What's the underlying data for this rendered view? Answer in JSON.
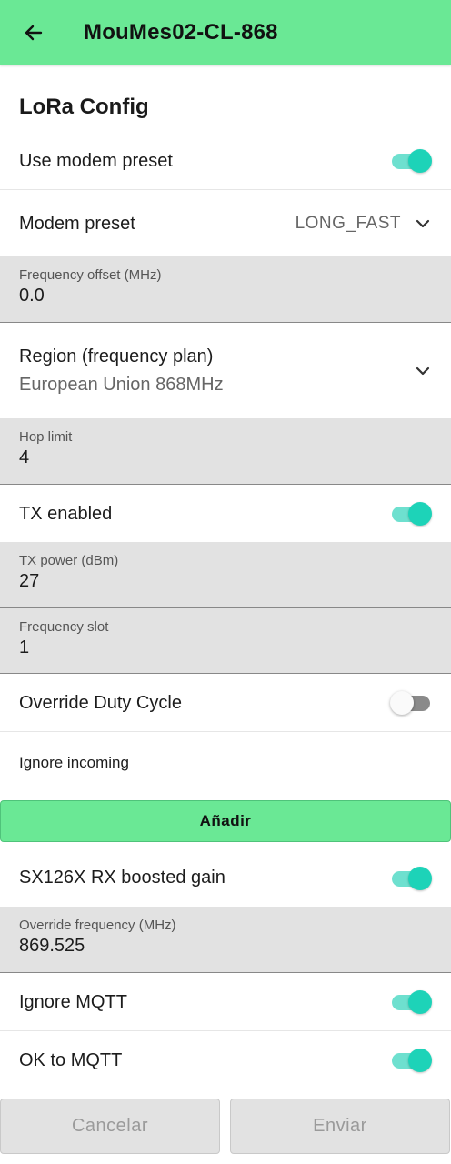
{
  "appbar": {
    "title": "MouMes02-CL-868"
  },
  "section": {
    "title": "LoRa Config"
  },
  "use_modem_preset": {
    "label": "Use modem preset",
    "checked": true
  },
  "modem_preset": {
    "label": "Modem preset",
    "value": "LONG_FAST"
  },
  "frequency_offset": {
    "label": "Frequency offset (MHz)",
    "value": "0.0"
  },
  "region": {
    "label": "Region (frequency plan)",
    "value": "European Union 868MHz"
  },
  "hop_limit": {
    "label": "Hop limit",
    "value": "4"
  },
  "tx_enabled": {
    "label": "TX enabled",
    "checked": true
  },
  "tx_power": {
    "label": "TX power (dBm)",
    "value": "27"
  },
  "frequency_slot": {
    "label": "Frequency slot",
    "value": "1"
  },
  "override_duty_cycle": {
    "label": "Override Duty Cycle",
    "checked": false
  },
  "ignore_incoming": {
    "label": "Ignore incoming",
    "add_label": "Añadir"
  },
  "sx126x_gain": {
    "label": "SX126X RX boosted gain",
    "checked": true
  },
  "override_frequency": {
    "label": "Override frequency (MHz)",
    "value": "869.525"
  },
  "ignore_mqtt": {
    "label": "Ignore MQTT",
    "checked": true
  },
  "ok_to_mqtt": {
    "label": "OK to MQTT",
    "checked": true
  },
  "actions": {
    "cancel_label": "Cancelar",
    "send_label": "Enviar"
  },
  "colors": {
    "accent": "#6ae895",
    "toggle_on": "#1dd3b8",
    "field_bg": "#e2e2e2"
  }
}
